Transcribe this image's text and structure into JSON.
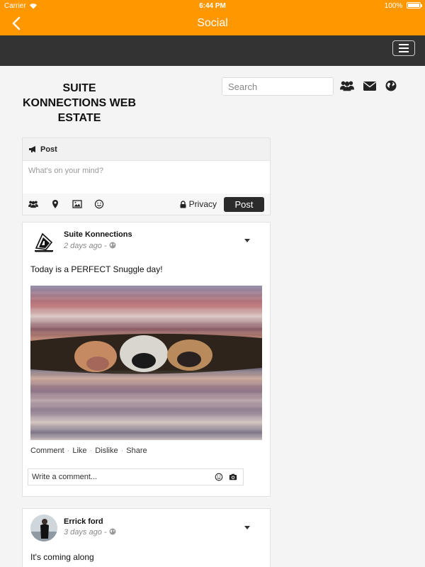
{
  "status_bar": {
    "carrier": "Carrier",
    "time": "6:44 PM",
    "battery": "100%"
  },
  "nav": {
    "title": "Social"
  },
  "header": {
    "site_title": "SUITE KONNECTIONS WEB ESTATE",
    "search_placeholder": "Search"
  },
  "composer": {
    "tab_label": "Post",
    "placeholder": "What's on your mind?",
    "privacy_label": "Privacy",
    "post_button": "Post",
    "tools": [
      "users-icon",
      "map-marker-icon",
      "image-icon",
      "smile-icon"
    ]
  },
  "posts": [
    {
      "author": "Suite Konnections",
      "time": "2 days ago - ",
      "text": "Today is a PERFECT Snuggle day!",
      "actions": {
        "comment": "Comment",
        "like": "Like",
        "dislike": "Dislike",
        "share": "Share",
        "sep": "·"
      },
      "comment_placeholder": "Write a comment..."
    },
    {
      "author": "Errick ford",
      "time": "3 days ago - ",
      "text": "It's coming along"
    }
  ],
  "colors": {
    "brand": "#ff9800",
    "dark_bar": "#333333",
    "button": "#2b2b2b"
  }
}
